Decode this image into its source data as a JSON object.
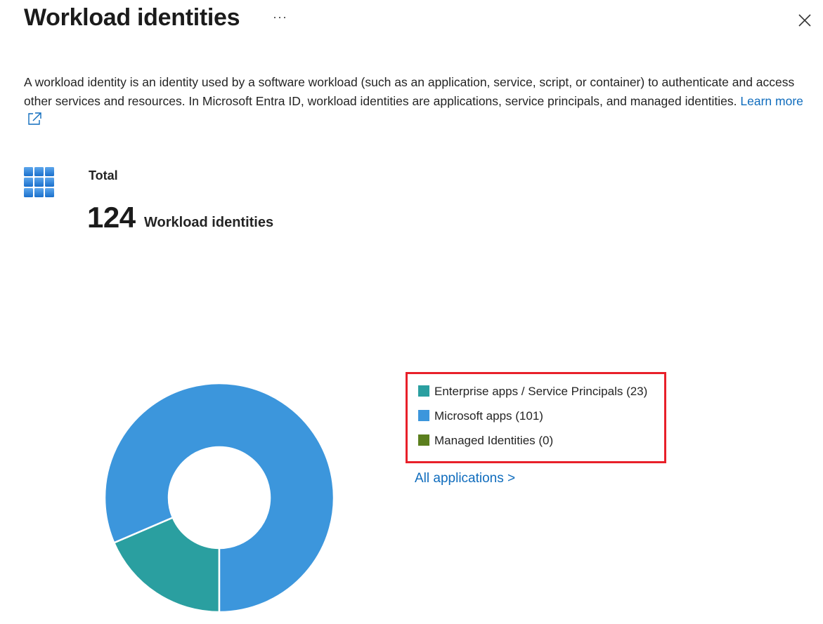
{
  "header": {
    "title": "Workload identities",
    "more_label": "···",
    "close_icon": "close-icon"
  },
  "description": {
    "text": "A workload identity is an identity used by a software workload (such as an application, service, script, or container) to authenticate and access other services and resources. In Microsoft Entra ID, workload identities are applications, service principals, and managed identities.",
    "learn_more": "Learn more",
    "learn_more_icon": "open-in-new-icon"
  },
  "summary": {
    "icon": "grid-apps-icon",
    "label": "Total",
    "count": "124",
    "unit": "Workload identities"
  },
  "chart_data": {
    "type": "pie",
    "categories": [
      "Enterprise apps / Service Principals",
      "Microsoft apps",
      "Managed Identities"
    ],
    "values": [
      23,
      101,
      0
    ],
    "colors": [
      "#2a9fa0",
      "#3c96dc",
      "#5b7f1e"
    ],
    "donut": true
  },
  "legend": {
    "items": [
      {
        "label": "Enterprise apps / Service Principals (23)",
        "color": "#2a9fa0"
      },
      {
        "label": "Microsoft apps (101)",
        "color": "#3c96dc"
      },
      {
        "label": "Managed Identities (0)",
        "color": "#5b7f1e"
      }
    ],
    "highlight_color": "#e8202a"
  },
  "links": {
    "all_applications": "All applications >"
  }
}
